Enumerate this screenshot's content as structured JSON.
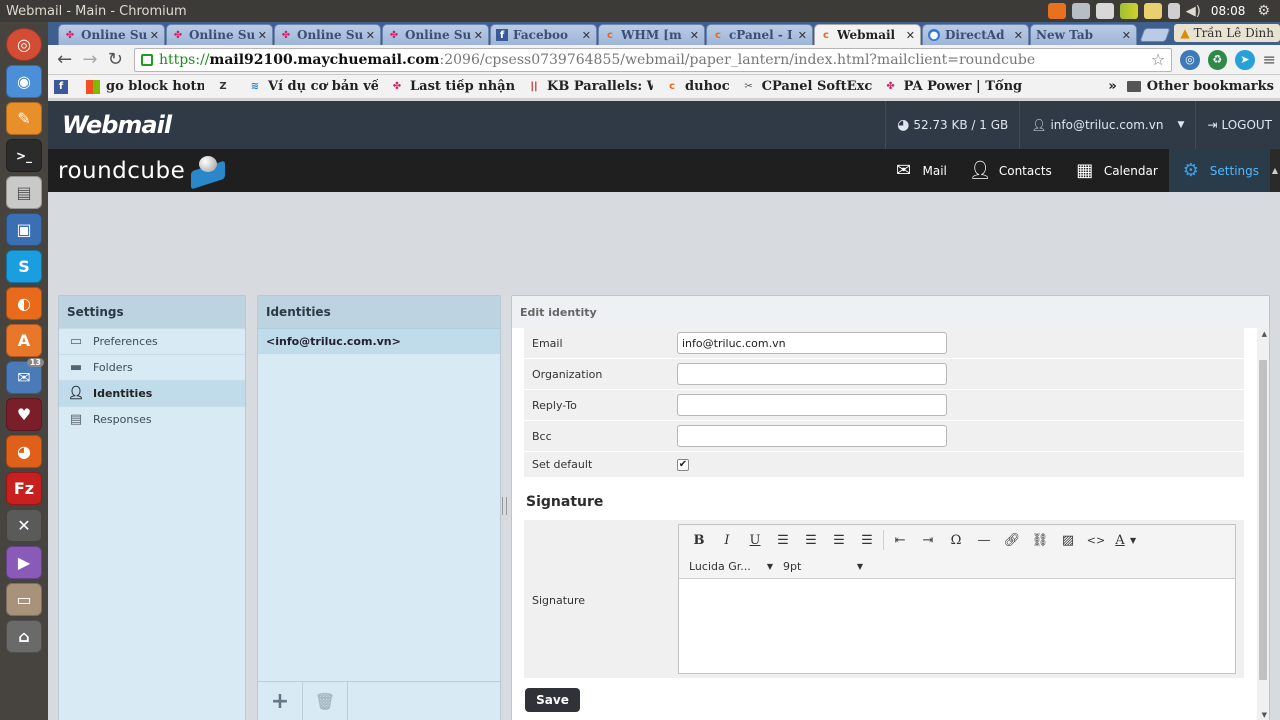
{
  "os": {
    "window_title": "Webmail - Main - Chromium",
    "time": "08:08",
    "launcher_badge": "13"
  },
  "browser": {
    "tabs": [
      {
        "title": "Online Su",
        "favicon": "ribbon-icon",
        "active": false
      },
      {
        "title": "Online Su",
        "favicon": "ribbon-icon",
        "active": false
      },
      {
        "title": "Online Su",
        "favicon": "ribbon-icon",
        "active": false
      },
      {
        "title": "Online Su",
        "favicon": "ribbon-icon",
        "active": false
      },
      {
        "title": "Faceboo",
        "favicon": "facebook-icon",
        "active": false
      },
      {
        "title": "WHM [m",
        "favicon": "cpanel-icon",
        "active": false
      },
      {
        "title": "cPanel - I",
        "favicon": "cpanel-icon",
        "active": false
      },
      {
        "title": "Webmail",
        "favicon": "cpanel-icon",
        "active": true
      },
      {
        "title": "DirectAd",
        "favicon": "globe-icon",
        "active": false
      },
      {
        "title": "New Tab",
        "favicon": "",
        "active": false
      }
    ],
    "profile_name": "Trần Lê Dinh",
    "url": {
      "scheme": "https://",
      "host": "mail92100.maychuemail.com",
      "path": ":2096/cpsess0739764855/webmail/paper_lantern/index.html?mailclient=roundcube"
    },
    "bookmarks": [
      {
        "label": "",
        "icon": "facebook-icon"
      },
      {
        "label": "go block hotmail !",
        "icon": "windows-icon"
      },
      {
        "label": "",
        "icon": "z-icon"
      },
      {
        "label": "Ví dụ cơ bản về lệ",
        "icon": "wave-icon"
      },
      {
        "label": "Last tiếp nhận",
        "icon": "ribbon-icon"
      },
      {
        "label": "KB Parallels: Wh",
        "icon": "parallels-icon"
      },
      {
        "label": "duhoc",
        "icon": "cpanel-icon"
      },
      {
        "label": "CPanel SoftExcep",
        "icon": "tool-icon"
      },
      {
        "label": "PA Power | Tổng c",
        "icon": "ribbon-icon"
      }
    ],
    "bookmarks_more": "»",
    "other_bookmarks": "Other bookmarks"
  },
  "webmail": {
    "logo": "Webmail",
    "quota": "52.73 KB / 1 GB",
    "user": "info@triluc.com.vn",
    "logout": "LOGOUT"
  },
  "roundcube": {
    "logo": "roundcube",
    "nav": [
      {
        "label": "Mail",
        "icon": "envelope-icon",
        "active": false
      },
      {
        "label": "Contacts",
        "icon": "person-icon",
        "active": false
      },
      {
        "label": "Calendar",
        "icon": "calendar-icon",
        "active": false
      },
      {
        "label": "Settings",
        "icon": "gear-icon",
        "active": true
      }
    ]
  },
  "settings_panel": {
    "title": "Settings",
    "items": [
      {
        "label": "Preferences",
        "icon": "monitor-icon",
        "active": false
      },
      {
        "label": "Folders",
        "icon": "folder-icon",
        "active": false
      },
      {
        "label": "Identities",
        "icon": "person-icon",
        "active": true
      },
      {
        "label": "Responses",
        "icon": "document-icon",
        "active": false
      }
    ]
  },
  "identities_panel": {
    "title": "Identities",
    "items": [
      "<info@triluc.com.vn>"
    ],
    "add_label": "+",
    "delete_icon": "trash-icon"
  },
  "edit_panel": {
    "title": "Edit identity",
    "fields": [
      {
        "label": "Email",
        "value": "info@triluc.com.vn"
      },
      {
        "label": "Organization",
        "value": ""
      },
      {
        "label": "Reply-To",
        "value": ""
      },
      {
        "label": "Bcc",
        "value": ""
      }
    ],
    "set_default_label": "Set default",
    "set_default_checked": true,
    "signature_heading": "Signature",
    "signature_label": "Signature",
    "editor": {
      "buttons": [
        "bold-icon",
        "italic-icon",
        "underline-icon",
        "align-left-icon",
        "align-center-icon",
        "align-right-icon",
        "align-justify-icon",
        "outdent-icon",
        "indent-icon",
        "omega-icon",
        "hr-icon",
        "link-icon",
        "unlink-icon",
        "image-icon",
        "code-icon",
        "text-color-icon"
      ],
      "font_family": "Lucida Gr...",
      "font_size": "9pt"
    },
    "save_label": "Save"
  }
}
